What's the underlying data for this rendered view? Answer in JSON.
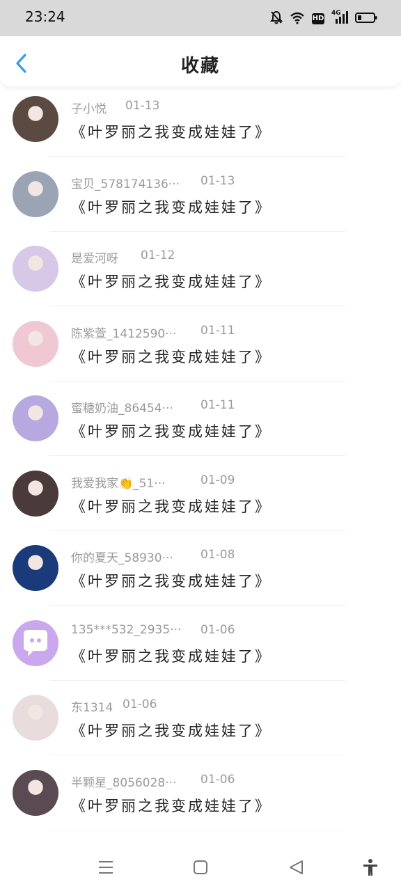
{
  "status_bar": {
    "time": "23:24",
    "hd": "HD",
    "network": "4G",
    "icons": [
      "mute-bell-icon",
      "wifi-icon",
      "hd-icon",
      "signal-icon",
      "battery-icon"
    ]
  },
  "header": {
    "title": "收藏",
    "back_icon": "chevron-left-icon",
    "accent": "#2f9ee8"
  },
  "favorites": [
    {
      "user": "子小悦",
      "date": "01-13",
      "title": "《叶罗丽之我变成娃娃了》",
      "avatar_color": "#5a4a42"
    },
    {
      "user": "宝贝_578174136···",
      "date": "01-13",
      "title": "《叶罗丽之我变成娃娃了》",
      "avatar_color": "#9aa4b4"
    },
    {
      "user": "是爱河呀",
      "date": "01-12",
      "title": "《叶罗丽之我变成娃娃了》",
      "avatar_color": "#d8c8e8"
    },
    {
      "user": "陈紫萱_1412590···",
      "date": "01-11",
      "title": "《叶罗丽之我变成娃娃了》",
      "avatar_color": "#f0c8d4"
    },
    {
      "user": "蜜糖奶油_86454···",
      "date": "01-11",
      "title": "《叶罗丽之我变成娃娃了》",
      "avatar_color": "#b8a8e0"
    },
    {
      "user": "我爱我家👏_51···",
      "date": "01-09",
      "title": "《叶罗丽之我变成娃娃了》",
      "avatar_color": "#4a3a3a"
    },
    {
      "user": "你的夏天_58930···",
      "date": "01-08",
      "title": "《叶罗丽之我变成娃娃了》",
      "avatar_color": "#1a3a7a"
    },
    {
      "user": "135***532_2935···",
      "date": "01-06",
      "title": "《叶罗丽之我变成娃娃了》",
      "avatar_color": "#c9a8ee"
    },
    {
      "user": "东1314",
      "date": "01-06",
      "title": "《叶罗丽之我变成娃娃了》",
      "avatar_color": "#e8dcdc"
    },
    {
      "user": "半颗星_8056028···",
      "date": "01-06",
      "title": "《叶罗丽之我变成娃娃了》",
      "avatar_color": "#5a4a52"
    }
  ],
  "nav_bar": {
    "icons": [
      "menu-icon",
      "home-icon",
      "back-triangle-icon",
      "accessibility-icon"
    ]
  }
}
